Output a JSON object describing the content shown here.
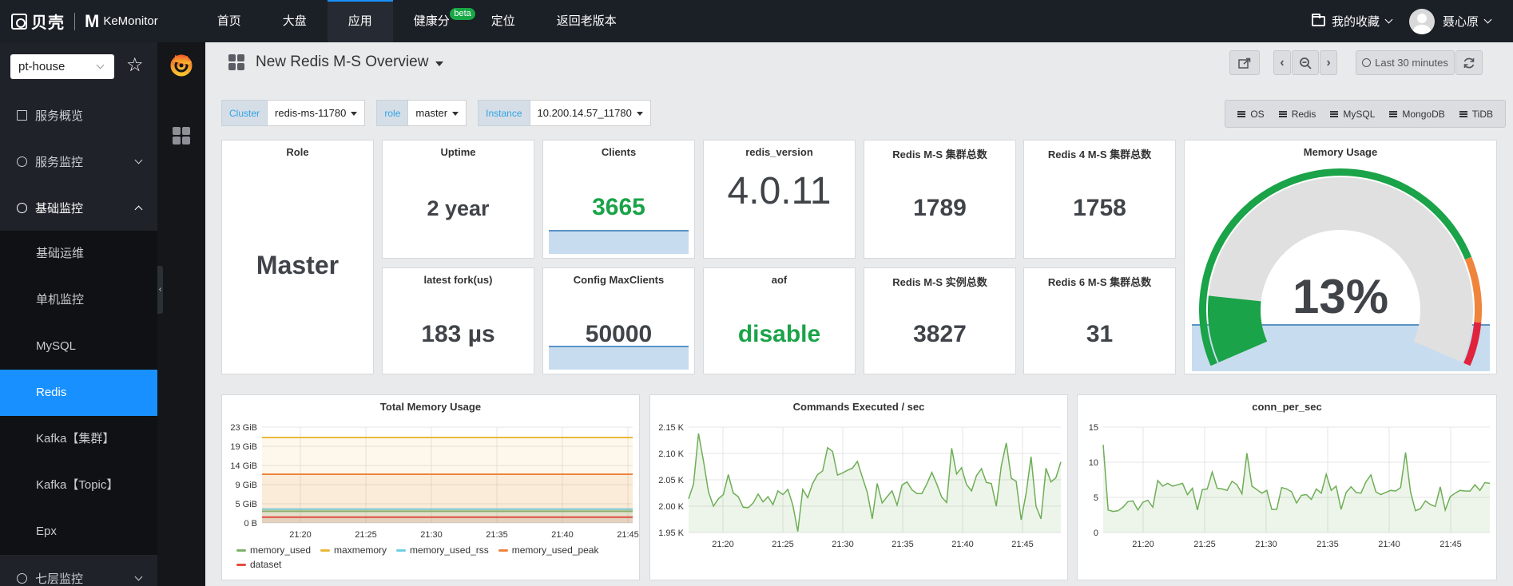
{
  "topnav": {
    "logo_text": "贝壳",
    "brand": "KeMonitor",
    "items": [
      {
        "label": "首页"
      },
      {
        "label": "大盘"
      },
      {
        "label": "应用"
      },
      {
        "label": "健康分"
      },
      {
        "label": "定位"
      },
      {
        "label": "返回老版本"
      }
    ],
    "beta_badge": "beta",
    "favorites": "我的收藏",
    "user": "聂心原"
  },
  "sidebar": {
    "project": "pt-house",
    "menu": [
      {
        "label": "服务概览"
      },
      {
        "label": "服务监控"
      },
      {
        "label": "基础监控"
      }
    ],
    "submenu": [
      {
        "label": "基础运维"
      },
      {
        "label": "单机监控"
      },
      {
        "label": "MySQL"
      },
      {
        "label": "Redis"
      },
      {
        "label": "Kafka【集群】"
      },
      {
        "label": "Kafka【Topic】"
      },
      {
        "label": "Epx"
      }
    ],
    "bottom_menu": {
      "label": "七层监控"
    }
  },
  "dashboard": {
    "title": "New Redis M-S Overview",
    "time_range": "Last 30 minutes",
    "variables": [
      {
        "label": "Cluster",
        "value": "redis-ms-11780"
      },
      {
        "label": "role",
        "value": "master"
      },
      {
        "label": "Instance",
        "value": "10.200.14.57_11780"
      }
    ],
    "links": [
      "OS",
      "Redis",
      "MySQL",
      "MongoDB",
      "TiDB"
    ],
    "stats": {
      "role": {
        "title": "Role",
        "value": "Master"
      },
      "uptime": {
        "title": "Uptime",
        "value": "2 year"
      },
      "clients": {
        "title": "Clients",
        "value": "3665"
      },
      "version": {
        "title": "redis_version",
        "value": "4.0.11"
      },
      "ms_clusters": {
        "title": "Redis M-S 集群总数",
        "value": "1789"
      },
      "r4_clusters": {
        "title": "Redis 4 M-S 集群总数",
        "value": "1758"
      },
      "fork": {
        "title": "latest fork(us)",
        "value": "183 µs"
      },
      "maxclients": {
        "title": "Config MaxClients",
        "value": "50000"
      },
      "aof": {
        "title": "aof",
        "value": "disable"
      },
      "ms_instances": {
        "title": "Redis M-S 实例总数",
        "value": "3827"
      },
      "r6_clusters": {
        "title": "Redis 6 M-S 集群总数",
        "value": "31"
      }
    },
    "memory_gauge": {
      "title": "Memory Usage",
      "value": "13%",
      "percent": 13
    }
  },
  "colors": {
    "accent": "#1890ff",
    "stat_green": "#1aa348",
    "series_green": "#6eae56"
  },
  "chart_data": [
    {
      "type": "line",
      "title": "Total Memory Usage",
      "x_ticks": [
        "21:20",
        "21:25",
        "21:30",
        "21:35",
        "21:40",
        "21:45"
      ],
      "y_ticks": [
        "23 GiB",
        "19 GiB",
        "14 GiB",
        "9 GiB",
        "5 GiB",
        "0 B"
      ],
      "ylim": [
        0,
        23
      ],
      "series": [
        {
          "name": "memory_used",
          "color": "#7eb26d",
          "value": 2.8
        },
        {
          "name": "maxmemory",
          "color": "#eab839",
          "value": 20.5
        },
        {
          "name": "memory_used_rss",
          "color": "#6ed0e0",
          "value": 3.3
        },
        {
          "name": "memory_used_peak",
          "color": "#ef843c",
          "value": 11.7
        },
        {
          "name": "dataset",
          "color": "#e24d42",
          "value": 1.4
        }
      ]
    },
    {
      "type": "line",
      "title": "Commands Executed / sec",
      "x_ticks": [
        "21:20",
        "21:25",
        "21:30",
        "21:35",
        "21:40",
        "21:45"
      ],
      "y_ticks": [
        "2.15 K",
        "2.10 K",
        "2.05 K",
        "2.00 K",
        "1.95 K"
      ],
      "ylim": [
        1.95,
        2.15
      ],
      "series": [
        {
          "values": [
            2.014,
            2.042,
            2.138,
            2.086,
            2.027,
            2.0,
            2.014,
            2.022,
            2.06,
            2.025,
            2.018,
            1.998,
            1.997,
            2.006,
            2.023,
            2.008,
            2.018,
            2.003,
            2.029,
            2.022,
            2.032,
            2.002,
            1.952,
            2.032,
            2.016,
            2.043,
            2.06,
            2.067,
            2.111,
            2.104,
            2.059,
            2.063,
            2.068,
            2.072,
            2.085,
            2.055,
            2.026,
            1.976,
            2.043,
            2.006,
            2.018,
            2.029,
            2.002,
            2.04,
            2.046,
            2.031,
            2.024,
            2.024,
            2.042,
            2.064,
            2.042,
            2.017,
            2.007,
            2.11,
            2.061,
            2.073,
            2.041,
            2.029,
            2.058,
            2.071,
            2.045,
            2.043,
            2.0,
            2.076,
            2.12,
            2.053,
            2.047,
            1.974,
            2.024,
            2.094,
            2.0,
            1.976,
            2.072,
            2.046,
            2.054,
            2.084
          ]
        }
      ]
    },
    {
      "type": "line",
      "title": "conn_per_sec",
      "x_ticks": [
        "21:20",
        "21:25",
        "21:30",
        "21:35",
        "21:40",
        "21:45"
      ],
      "y_ticks": [
        "15",
        "10",
        "5",
        "0"
      ],
      "ylim": [
        0,
        15
      ],
      "series": [
        {
          "values": [
            12.5,
            3.2,
            3.0,
            3.1,
            3.6,
            4.4,
            4.5,
            3.2,
            4.3,
            4.6,
            3.6,
            7.4,
            6.6,
            7.0,
            6.6,
            6.8,
            7.0,
            5.4,
            6.3,
            3.2,
            6.1,
            6.2,
            8.6,
            6.3,
            6.2,
            6.0,
            7.3,
            6.8,
            5.5,
            11.3,
            6.6,
            6.1,
            5.6,
            6.0,
            3.3,
            3.3,
            6.4,
            6.2,
            5.8,
            4.2,
            5.3,
            5.4,
            4.7,
            6.2,
            5.6,
            8.3,
            6.0,
            6.6,
            3.3,
            5.7,
            6.5,
            5.7,
            5.6,
            7.2,
            8.2,
            5.8,
            5.4,
            5.7,
            6.0,
            5.9,
            6.4,
            11.4,
            5.8,
            3.1,
            3.4,
            4.5,
            4.0,
            3.7,
            6.5,
            3.2,
            5.1,
            5.6,
            6.0,
            5.9,
            5.9,
            6.8,
            6.0,
            7.1,
            7.0
          ]
        }
      ]
    }
  ]
}
